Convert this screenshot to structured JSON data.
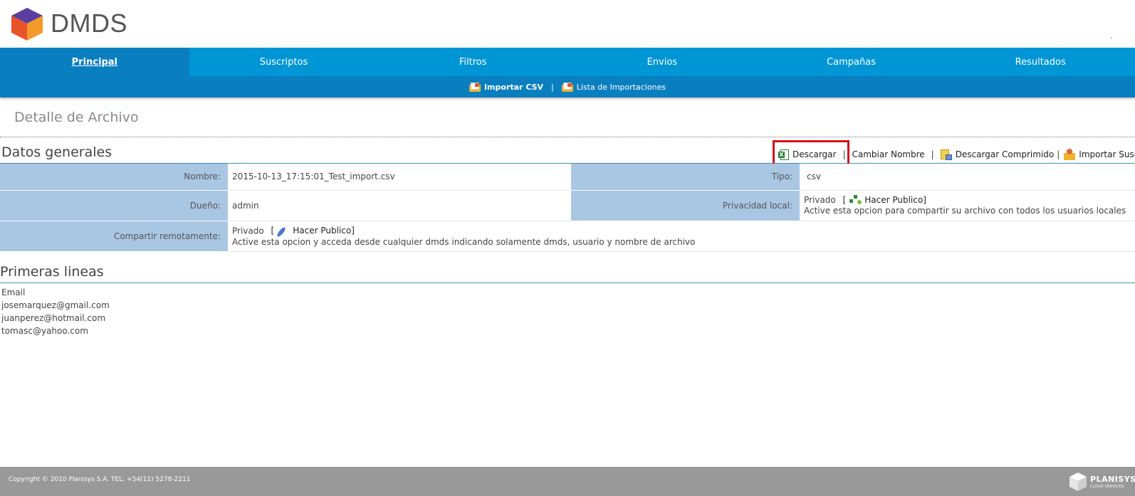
{
  "header": {
    "brand": "DMDS"
  },
  "main_nav": [
    {
      "label": "Principal",
      "active": true
    },
    {
      "label": "Suscriptos"
    },
    {
      "label": "Filtros"
    },
    {
      "label": "Envios"
    },
    {
      "label": "Campañas"
    },
    {
      "label": "Resultados"
    }
  ],
  "sub_nav": {
    "import_csv": "Importar CSV",
    "separator": "|",
    "import_list": "Lista de Importaciones"
  },
  "page": {
    "title": "Detalle de Archivo"
  },
  "general": {
    "title": "Datos generales",
    "actions": {
      "download": "Descargar",
      "rename": "Cambiar Nombre",
      "download_zip": "Descargar Comprimido",
      "import_subs": "Importar Suscripto",
      "pipe": "|"
    },
    "fields": {
      "name_label": "Nombre:",
      "name_value": "2015-10-13_17:15:01_Test_import.csv",
      "type_label": "Tipo:",
      "type_value": "csv",
      "owner_label": "Dueño:",
      "owner_value": "admin",
      "local_privacy_label": "Privacidad local:",
      "local_privacy_state": "Privado",
      "make_public_open": "[",
      "make_public": "Hacer Publico]",
      "local_privacy_desc": "Active esta opcion para compartir su archivo con todos los usuarios locales",
      "remote_label": "Compartir remotamente:",
      "remote_state": "Privado",
      "remote_desc": "Active esta opcion y acceda desde cualquier dmds indicando solamente dmds, usuario y nombre de archivo"
    }
  },
  "first_lines": {
    "title": "Primeras lineas",
    "lines": [
      "Email",
      "josemarquez@gmail.com",
      "juanperez@hotmail.com",
      "tomasc@yahoo.com"
    ]
  },
  "footer": {
    "copyright": "Copyright © 2010 Planisys S.A. TEL: +54(11) 5278-2211",
    "brand": "PLANISYS",
    "brand_sub": "CLOUD SERVICES"
  },
  "colors": {
    "nav": "#0096d6",
    "nav_active": "#0a7fc0",
    "label_bg": "#a9c6e2",
    "highlight": "#d0121b",
    "footer": "#999999"
  }
}
